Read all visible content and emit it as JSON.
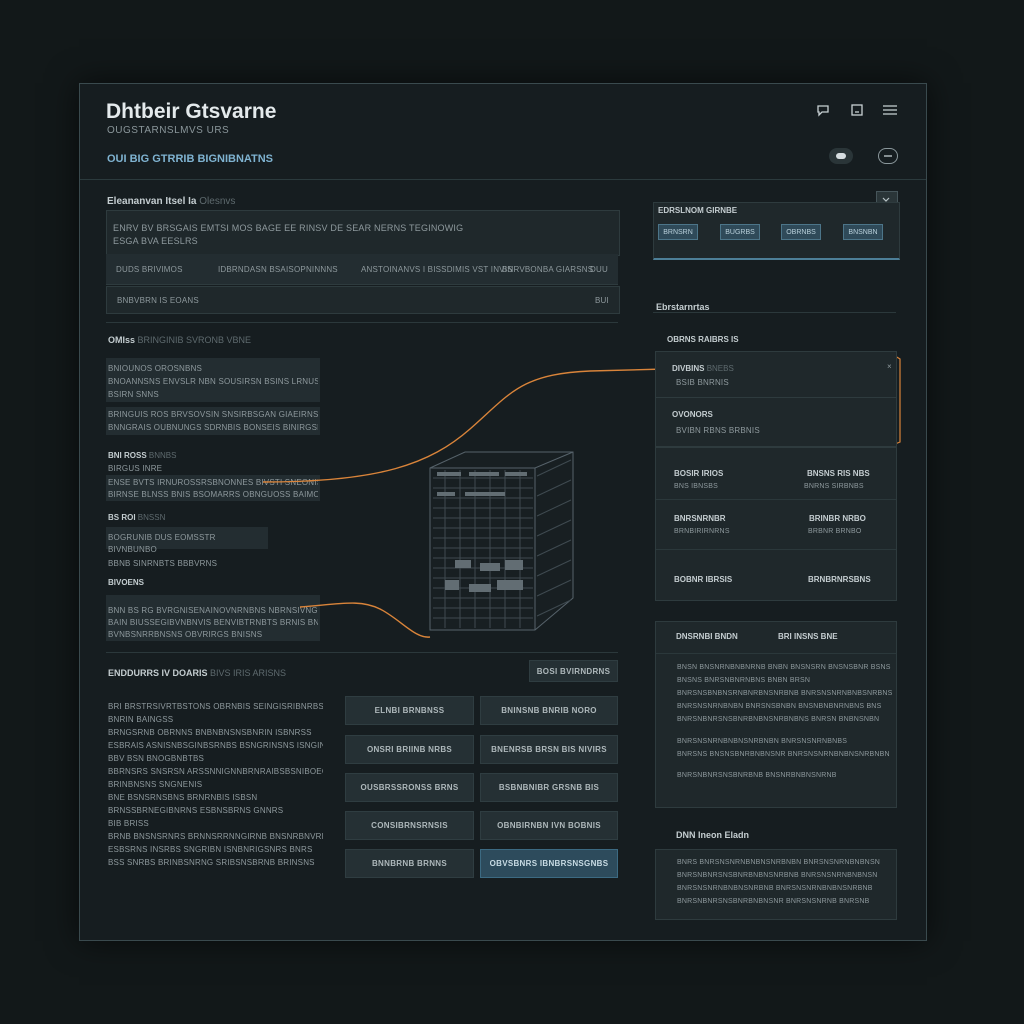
{
  "header": {
    "title": "Dhtbeir Gtsvarne",
    "subtitle": "OUGSTARNSLMVS URS",
    "tagline": "OUI BIG GTRRIB BIGNIBNATNS",
    "icons": [
      "chat-icon",
      "window-icon",
      "menu-icon"
    ],
    "toggle_icons": [
      "pill-toggle-icon",
      "ring-toggle-icon"
    ]
  },
  "overview": {
    "heading": "Eleananvan Itsel Ia",
    "heading_muted": "Olesnvs",
    "line1": "ENRV BV BRSGAIS EMTSI MOS BAGE EE RINSV DE SEAR NERNS TEGINOWIG",
    "line2": "ESGA BVA EESLRS",
    "table_headers": [
      "DUDS BRIVIMOS",
      "IDBRNDASN BSAIS",
      "OPNINNNS",
      "ANSTOINANVS I BISSDIMIS VST INVIS",
      "BNRVBONBA GIARSNS",
      "DUU"
    ],
    "row_label": "BNBVBRN IS EOANS",
    "row_end": "BUI"
  },
  "left_col": {
    "heading": "OMIss",
    "heading_muted": "BRINGINIB SVRONB VBNE",
    "group1_title": "BNIOUNOS OROSNBNS",
    "group1_line": "BNOANNSNS ENVSLR NBN SOUSIRSN BSINS LRNUSNS",
    "group1_line2": "BSIRN SNNS",
    "group2_line": "BRINGUIS ROS BRVSOVSIN SNSIRBSGAN GIAEIRNS ENN BI",
    "group2_line2": "BNNGRAIS OUBNUNGS SDRNBIS BONSEIS BINIRGSLENIS",
    "group3_title": "BNI ROSS",
    "group3_muted": "BNNBS",
    "group3_sub": "BIRGUS INRE",
    "group3_line": "ENSE BVTS IRNUROSSRSBNONNES BIVSTI SNEONIS BNSNS",
    "group3_line2": "BIRNSE BLNSS BNIS BSOMARRS OBNGUOSS BAIMONMS",
    "group4_title": "BS ROI",
    "group4_muted": "BNSSN",
    "field1": "BOGRUNIB DUS EOMSSTR",
    "field2": "BIVNBUNBO",
    "field3": "BBNB SINRNBTS BBBVRNS",
    "group5_title": "BIVOENS",
    "group5_line": "BNN BS RG BVRGNISENAINOVNRNBNS NBRNSIVNGRSIARIS",
    "group5_line2": "BAIN BIUSSEGIBVNBNVIS BENVIBTRNBTS BRNIS BNBNGS",
    "group5_line3": "BVNBSNRRBNSNS OBVRIRGS BNISNS"
  },
  "center_diagram": {
    "label": "server-rack-illustration"
  },
  "bottom_left": {
    "heading": "ENDDURRS IV DOARIS",
    "heading_muted": "BIVS IRIS ARISNS",
    "action": "BOSI BVIRNDRNS",
    "lines": [
      "BRI BRSTRSIVRTBSTONS OBRNBIS SEINGISRIBNRBS",
      "BNRIN BAINGSS",
      "BRNGSRNB OBRNNS BNBNBNSNSBNRIN ISBNRSS",
      "ESBRAIS ASNISNBSGINBSRNBS BSNGRINSNS ISNGINS",
      "BBV BSN BNOGBNBTBS",
      "BBRNSRS SNSRSN ARSSNNIGNNBRNRAIBSBSNIBOEGSSE",
      "BRINBNSNS SNGNENIS",
      "BNE BSNSRNSBNS BRNRNBIS ISBSN",
      "BRNSSBRNEGIBNRNS ESBNSBRNS GNNRS",
      "BIB BRISS",
      "BRNB BNSNSRNRS BRNNSRRNNGIRNB BNSNRBNVRNGS",
      "ESBSRNS INSRBS SNGRIBN ISNBNRIGSNRS BNRS",
      "BSS SNRBS BRINBSNRNG SRIBSNSBRNB BRINSNS"
    ]
  },
  "button_grid": {
    "buttons": [
      {
        "label": "ELNBI BRNBNSS",
        "active": false
      },
      {
        "label": "BNINSNB BNRIB NORO",
        "active": false
      },
      {
        "label": "ONSRI BRIINB NRBS",
        "active": false
      },
      {
        "label": "BNENRSB BRSN BIS NIVIRS",
        "active": false
      },
      {
        "label": "OUSBRSSRONSS BRNS",
        "active": false
      },
      {
        "label": "BSBNBNIBR GRSNB BIS",
        "active": false
      },
      {
        "label": "CONSIBRNSRNSIS",
        "active": false
      },
      {
        "label": "OBNBIRNBN IVN BOBNIS",
        "active": false
      },
      {
        "label": "BNNBRNB BRNNS",
        "active": false
      },
      {
        "label": "OBVSBNRS IBNBRSNSGNBS",
        "active": true
      }
    ]
  },
  "right_col": {
    "status_title": "EDRSLNOM GIRNBE",
    "chips": [
      "BRNSRN",
      "BUGRBS",
      "OBRNBS",
      "BNSNBN"
    ],
    "section_title": "Ebrstarnrtas",
    "sub_title": "OBRNS RAIBRS IS",
    "card_a_title": "DIVBINS",
    "card_a_muted": "BNEBS",
    "card_a_line": "BSIB BNRNIS",
    "card_b_title": "OVONORS",
    "card_b_line": "BVIBN RBNS BRBNIS",
    "grid": [
      {
        "title": "BOSIR IRIOS",
        "sub": "BNS IBNSBS"
      },
      {
        "title": "BNSNS RIS NBS",
        "sub": "BNRNS SIRBNBS"
      },
      {
        "title": "BNRSNRNBR",
        "sub": "BRNBIRIRNRNS"
      },
      {
        "title": "BRINBR NRBO",
        "sub": "BRBNR BRNBO"
      },
      {
        "title": "BOBNR IBRSIS",
        "sub": ""
      },
      {
        "title": "BRNBRNRSBNS",
        "sub": ""
      }
    ],
    "desc_title": "DNSRNBI BNDN",
    "desc_title2": "BRI INSNS BNE",
    "desc_lines": [
      "BNSN BNSNRNBNBNRNB BNBN BNSNSRN BNSNSBNR BSNS",
      "BNSNS BNRSNBNRNBNS BNBN BRSN",
      "BNRSNSBNBNSRNBNRBNSNRBNB BNRSNSNRNBNBSNRBNS",
      "BNRSNSNRNBNBN BNRSNSBNBN BNSNBNBNRNBNS BNS",
      "BNRSNBNRSNSBNRBNBNSNRBNBNS BNRSN BNBNSNBN",
      "BNRSNSNRNBNBNSNRBNBN BNRSNSNRNBNBS",
      "BNRSNS BNSNSBNRBNBNSNR BNRSNSNRNBNBNSNRBNBN",
      "BNRSNBNRSNSBNRBNB BNSNRBNBNSNRNB"
    ],
    "note_title": "DNN Ineon Eladn",
    "note_lines": [
      "BNRS BNRSNSNRNBNBNSNRBNBN BNRSNSNRNBNBNSN",
      "BNRSNBNRSNSBNRBNBNSNRBNB BNRSNSNRNBNBNSN",
      "BNRSNSNRNBNBNSNRBNB BNRSNSNRNBNBNSNRBNB",
      "BNRSNBNRSNSBNRBNBNSNR BNRSNSNRNB BNRSNB"
    ]
  },
  "colors": {
    "accent": "#7fb3d1",
    "connector": "#d9843a",
    "panel": "#1f282b",
    "background": "#121819"
  }
}
